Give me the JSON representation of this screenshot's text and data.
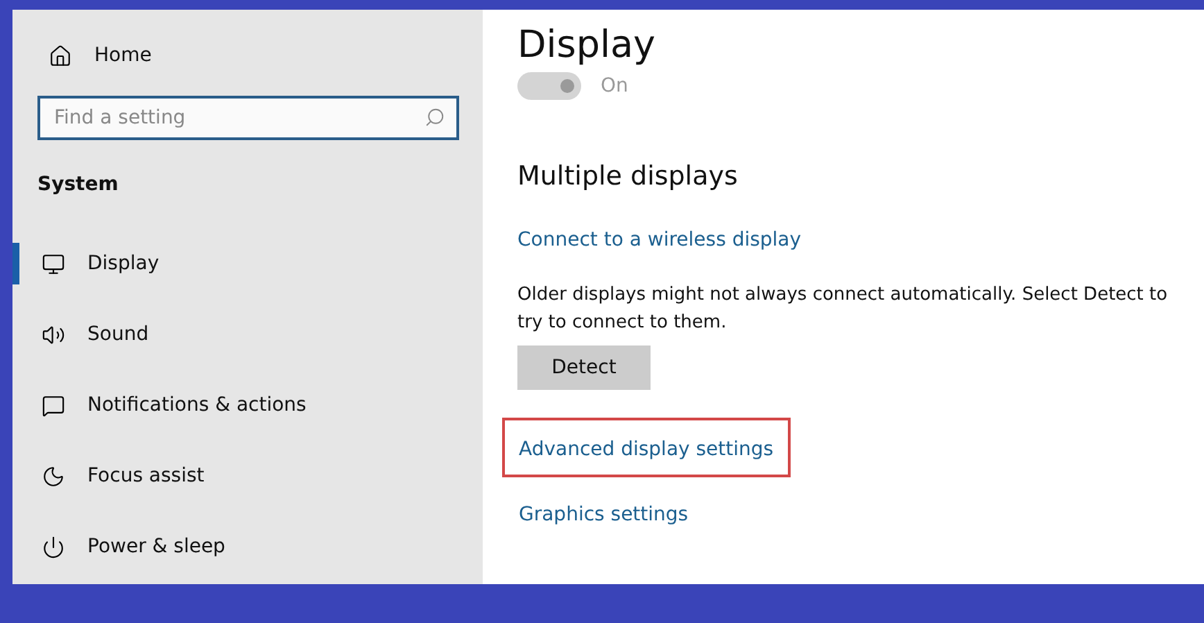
{
  "sidebar": {
    "home": {
      "label": "Home"
    },
    "search": {
      "placeholder": "Find a setting"
    },
    "section": "System",
    "items": [
      {
        "kind": "display",
        "label": "Display",
        "selected": true
      },
      {
        "kind": "sound",
        "label": "Sound",
        "selected": false
      },
      {
        "kind": "notifications",
        "label": "Notifications & actions",
        "selected": false
      },
      {
        "kind": "focus",
        "label": "Focus assist",
        "selected": false
      },
      {
        "kind": "power",
        "label": "Power & sleep",
        "selected": false
      }
    ]
  },
  "main": {
    "title": "Display",
    "toggle": {
      "on": true,
      "disabled": true,
      "label": "On"
    },
    "section": "Multiple displays",
    "connect_link": "Connect to a wireless display",
    "description": "Older displays might not always connect automatically. Select Detect to try to connect to them.",
    "detect_button": "Detect",
    "links": [
      {
        "label": "Advanced display settings",
        "highlighted": true
      },
      {
        "label": "Graphics settings",
        "highlighted": false
      }
    ]
  }
}
